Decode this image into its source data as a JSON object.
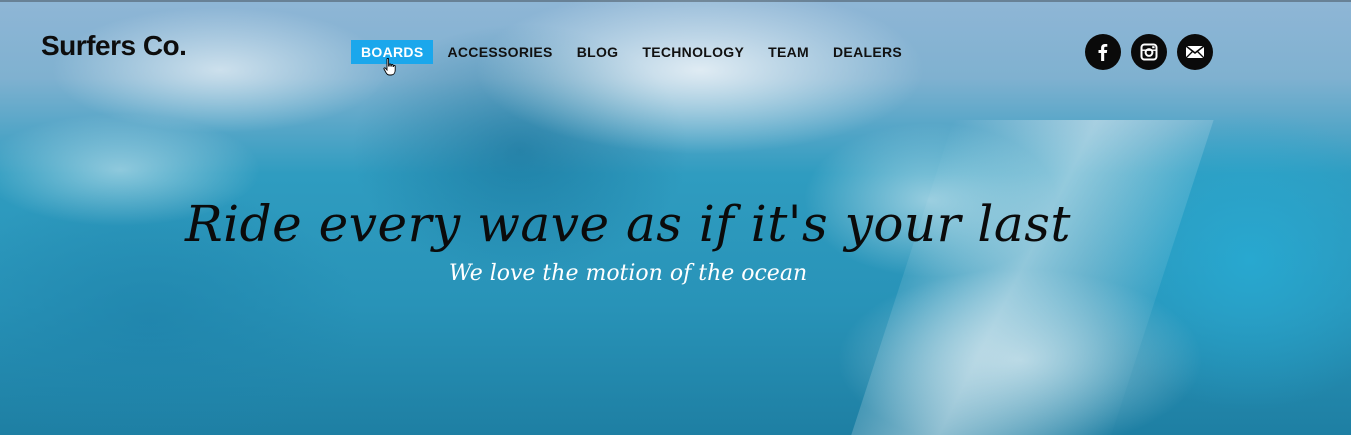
{
  "brand": {
    "logo_text": "Surfers Co."
  },
  "nav": {
    "items": [
      {
        "label": "BOARDS",
        "active": true
      },
      {
        "label": "ACCESSORIES",
        "active": false
      },
      {
        "label": "BLOG",
        "active": false
      },
      {
        "label": "TECHNOLOGY",
        "active": false
      },
      {
        "label": "TEAM",
        "active": false
      },
      {
        "label": "DEALERS",
        "active": false
      }
    ],
    "active_color": "#1aa7ec"
  },
  "social": {
    "icons": [
      "facebook-icon",
      "instagram-icon",
      "email-icon"
    ]
  },
  "hero": {
    "headline": "Ride every wave as if it's your last",
    "subheadline": "We love the motion of the ocean"
  }
}
